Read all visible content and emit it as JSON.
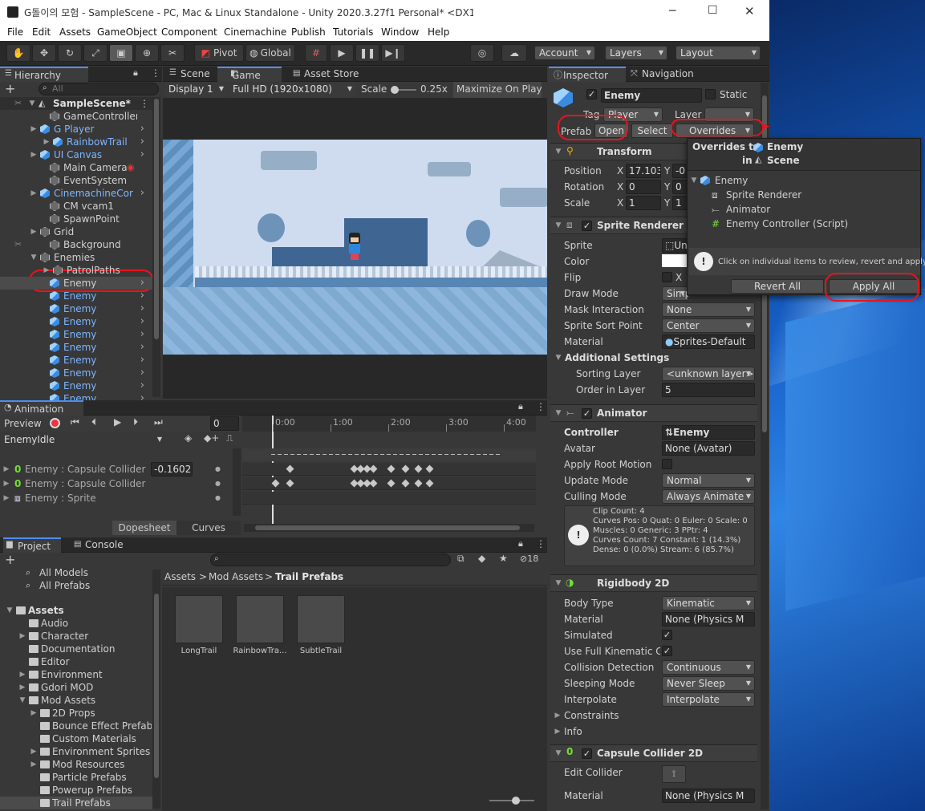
{
  "title_bar": {
    "title": "G돌이의 모험 - SampleScene - PC, Mac & Linux Standalone - Unity 2020.3.27f1 Personal* <DX11>",
    "minimize": "─",
    "maximize": "☐",
    "close": "✕"
  },
  "menu": [
    "File",
    "Edit",
    "Assets",
    "GameObject",
    "Component",
    "Cinemachine",
    "Publish",
    "Tutorials",
    "Window",
    "Help"
  ],
  "toolbar": {
    "pivot": "Pivot",
    "global": "Global",
    "account": "Account",
    "layers": "Layers",
    "layout": "Layout"
  },
  "hierarchy": {
    "tab": "Hierarchy",
    "search_placeholder": "All",
    "plus": "+",
    "scene": "SampleScene*",
    "items": [
      {
        "label": "GameController",
        "blue": false
      },
      {
        "label": "G Player",
        "blue": true
      },
      {
        "label": "RainbowTrail",
        "blue": true
      },
      {
        "label": "UI Canvas",
        "blue": true
      },
      {
        "label": "Main Camera",
        "blue": false
      },
      {
        "label": "EventSystem",
        "blue": false
      },
      {
        "label": "CinemachineCor",
        "blue": true
      },
      {
        "label": "CM vcam1",
        "blue": false
      },
      {
        "label": "SpawnPoint",
        "blue": false
      },
      {
        "label": "Grid",
        "blue": false
      },
      {
        "label": "Background",
        "blue": false
      },
      {
        "label": "Enemies",
        "blue": false
      },
      {
        "label": "PatrolPaths",
        "blue": false
      },
      {
        "label": "Enemy",
        "blue": false
      },
      {
        "label": "Enemy",
        "blue": true
      },
      {
        "label": "Enemy",
        "blue": true
      },
      {
        "label": "Enemy",
        "blue": true
      },
      {
        "label": "Enemy",
        "blue": true
      },
      {
        "label": "Enemy",
        "blue": true
      },
      {
        "label": "Enemy",
        "blue": true
      },
      {
        "label": "Enemy",
        "blue": true
      },
      {
        "label": "Enemy",
        "blue": true
      },
      {
        "label": "Enemy",
        "blue": true
      }
    ]
  },
  "game": {
    "tab_scene": "Scene",
    "tab_game": "Game",
    "tab_store": "Asset Store",
    "display": "Display 1",
    "resolution": "Full HD (1920x1080)",
    "scale_label": "Scale",
    "scale_value": "0.25x",
    "maximize": "Maximize On Play"
  },
  "animation": {
    "tab": "Animation",
    "preview": "Preview",
    "frame": "0",
    "clip": "EnemyIdle",
    "times": [
      "0:00",
      "1:00",
      "2:00",
      "3:00",
      "4:00"
    ],
    "tracks": [
      {
        "label": "Enemy : Capsule Collider 2D",
        "value": "-0.1602"
      },
      {
        "label": "Enemy : Capsule Collider 2D.Size",
        "value": ""
      },
      {
        "label": "Enemy : Sprite",
        "value": ""
      }
    ],
    "dopesheet": "Dopesheet",
    "curves": "Curves"
  },
  "project": {
    "tab_project": "Project",
    "tab_console": "Console",
    "hidden_count": "18",
    "favorites": [
      "All Models",
      "All Prefabs"
    ],
    "tree": [
      {
        "label": "Assets",
        "level": 0,
        "arrow": true
      },
      {
        "label": "Audio",
        "level": 1,
        "arrow": false
      },
      {
        "label": "Character",
        "level": 1,
        "arrow": true
      },
      {
        "label": "Documentation",
        "level": 1,
        "arrow": false
      },
      {
        "label": "Editor",
        "level": 1,
        "arrow": false
      },
      {
        "label": "Environment",
        "level": 1,
        "arrow": true
      },
      {
        "label": "Gdori MOD",
        "level": 1,
        "arrow": true
      },
      {
        "label": "Mod Assets",
        "level": 1,
        "arrow": true
      },
      {
        "label": "2D Props",
        "level": 2,
        "arrow": true
      },
      {
        "label": "Bounce Effect Prefabs",
        "level": 2,
        "arrow": false
      },
      {
        "label": "Custom Materials",
        "level": 2,
        "arrow": false
      },
      {
        "label": "Environment Sprites C",
        "level": 2,
        "arrow": true
      },
      {
        "label": "Mod Resources",
        "level": 2,
        "arrow": true
      },
      {
        "label": "Particle Prefabs",
        "level": 2,
        "arrow": false
      },
      {
        "label": "Powerup Prefabs",
        "level": 2,
        "arrow": false
      },
      {
        "label": "Trail Prefabs",
        "level": 2,
        "arrow": false
      }
    ],
    "breadcrumb": [
      "Assets",
      "Mod Assets",
      "Trail Prefabs"
    ],
    "assets": [
      "LongTrail",
      "RainbowTra...",
      "SubtleTrail"
    ]
  },
  "inspector": {
    "tab_inspector": "Inspector",
    "tab_navigation": "Navigation",
    "name": "Enemy",
    "static": "Static",
    "tag_label": "Tag",
    "tag_value": "Player",
    "layer_label": "Layer",
    "layer_value": "",
    "prefab_label": "Prefab",
    "open": "Open",
    "select": "Select",
    "overrides": "Overrides",
    "transform": {
      "title": "Transform",
      "position": "Position",
      "rotation": "Rotation",
      "scale": "Scale",
      "x": "X",
      "y": "Y",
      "pos_x": "17.103",
      "pos_y": "-0",
      "rot_x": "0",
      "rot_y": "0",
      "scale_x": "1",
      "scale_y": "1"
    },
    "sprite_renderer": {
      "title": "Sprite Renderer",
      "sprite": "Sprite",
      "sprite_value": "Un",
      "color": "Color",
      "flip": "Flip",
      "flip_x": "X",
      "draw_mode": "Draw Mode",
      "draw_mode_value": "Simple",
      "mask": "Mask Interaction",
      "mask_value": "None",
      "sort_point": "Sprite Sort Point",
      "sort_point_value": "Center",
      "material": "Material",
      "material_value": "Sprites-Default",
      "additional": "Additional Settings",
      "sorting_layer": "Sorting Layer",
      "sorting_layer_value": "<unknown layer>",
      "order": "Order in Layer",
      "order_value": "5"
    },
    "animator": {
      "title": "Animator",
      "controller": "Controller",
      "controller_value": "Enemy",
      "avatar": "Avatar",
      "avatar_value": "None (Avatar)",
      "root_motion": "Apply Root Motion",
      "update_mode": "Update Mode",
      "update_mode_value": "Normal",
      "culling": "Culling Mode",
      "culling_value": "Always Animate",
      "info": [
        "Clip Count: 4",
        "Curves Pos: 0 Quat: 0 Euler: 0 Scale: 0",
        "Muscles: 0 Generic: 3 PPtr: 4",
        "Curves Count: 7 Constant: 1 (14.3%)",
        "Dense: 0 (0.0%) Stream: 6 (85.7%)"
      ]
    },
    "rigidbody": {
      "title": "Rigidbody 2D",
      "body_type": "Body Type",
      "body_type_value": "Kinematic",
      "material": "Material",
      "material_value": "None (Physics M",
      "simulated": "Simulated",
      "full_kinematic": "Use Full Kinematic Co",
      "collision": "Collision Detection",
      "collision_value": "Continuous",
      "sleeping": "Sleeping Mode",
      "sleeping_value": "Never Sleep",
      "interpolate": "Interpolate",
      "interpolate_value": "Interpolate",
      "constraints": "Constraints",
      "info": "Info"
    },
    "capsule": {
      "title": "Capsule Collider 2D",
      "edit": "Edit Collider",
      "material": "Material",
      "material_value": "None (Physics M"
    }
  },
  "overrides_popup": {
    "title_prefix": "Overrides to",
    "title_name": "Enemy",
    "in": "in",
    "scene": "Scene",
    "items": [
      "Enemy",
      "Sprite Renderer",
      "Animator",
      "Enemy Controller (Script)"
    ],
    "hint": "Click on individual items to review, revert and apply.",
    "revert": "Revert All",
    "apply": "Apply All"
  }
}
